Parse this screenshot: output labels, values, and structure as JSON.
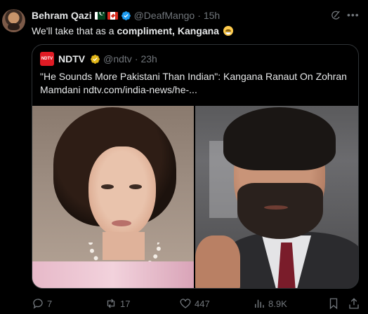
{
  "author": {
    "display_name": "Behram Qazi",
    "handle": "@DeafMango",
    "time": "15h",
    "flags": [
      "pakistan-flag",
      "canada-flag"
    ]
  },
  "tweet": {
    "text_plain": "We'll take that as a ",
    "text_bold": "compliment, Kangana",
    "emoji": "grinning-face-emoji"
  },
  "quote": {
    "display_name": "NDTV",
    "logo_text": "NDTV",
    "handle": "@ndtv",
    "time": "23h",
    "text": "\"He Sounds More Pakistani Than Indian\": Kangana Ranaut On Zohran Mamdani ndtv.com/india-news/he-..."
  },
  "actions": {
    "replies": "7",
    "reposts": "17",
    "likes": "447",
    "views": "8.9K"
  },
  "icons": {
    "verified_color": "#1d9bf0",
    "verified_gold_color": "#e2b719",
    "muted_color": "#71767b"
  }
}
